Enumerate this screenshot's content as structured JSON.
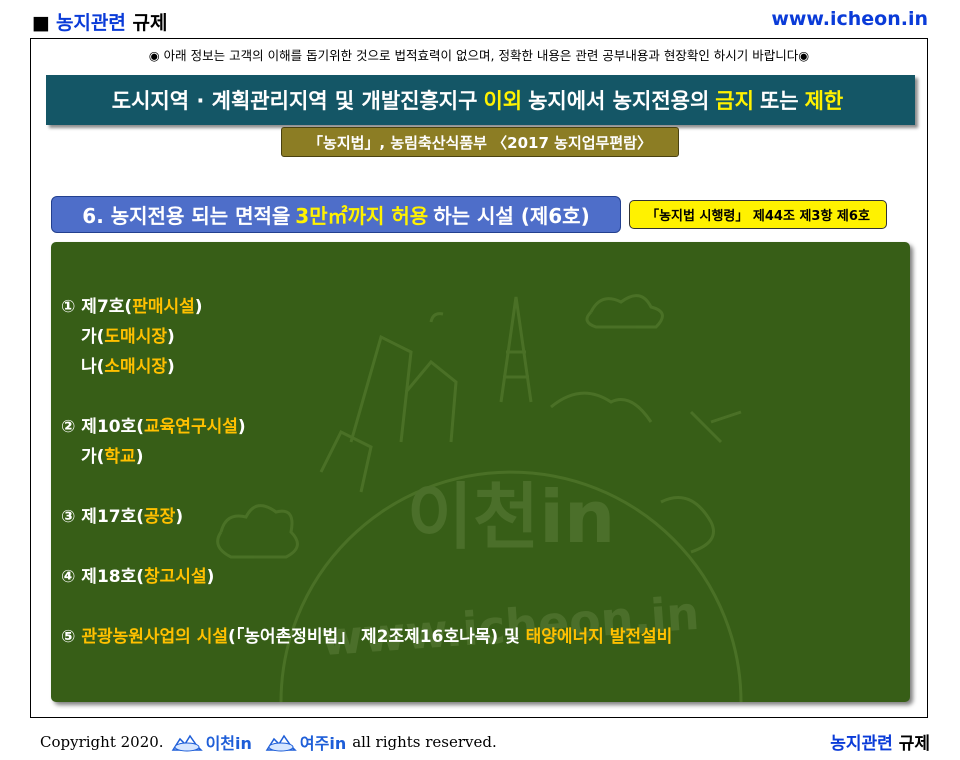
{
  "header": {
    "square": "■",
    "title_highlight": "농지관련",
    "title_rest": "규제",
    "site_url": "www.icheon.in"
  },
  "notice": "◉ 아래 정보는 고객의 이해를 돕기위한 것으로 법적효력이 없으며, 정확한 내용은 관련 공부내용과 현장확인 하시기 바랍니다◉",
  "banner": {
    "part1": "도시지역 · 계획관리지역 및 개발진흥지구",
    "highlight1": "이외",
    "part2": "농지에서 농지전용의",
    "highlight2": "금지",
    "part3": "또는",
    "highlight3": "제한"
  },
  "source": "「농지법」, 농림축산식품부 〈2017 농지업무편람〉",
  "section": {
    "prefix": "6. 농지전용 되는 면적을",
    "highlight": "3만㎡까지 허용",
    "suffix": "하는 시설 (제6호)"
  },
  "law_ref": "「농지법 시행령」 제44조 제3항 제6호",
  "items": {
    "i1": {
      "num": "① 제7호(",
      "name": "판매시설",
      "close": ")"
    },
    "i1a": {
      "num": "가(",
      "name": "도매시장",
      "close": ")"
    },
    "i1b": {
      "num": "나(",
      "name": "소매시장",
      "close": ")"
    },
    "i2": {
      "num": "② 제10호(",
      "name": "교육연구시설",
      "close": ")"
    },
    "i2a": {
      "num": "가(",
      "name": "학교",
      "close": ")"
    },
    "i3": {
      "num": "③ 제17호(",
      "name": "공장",
      "close": ")"
    },
    "i4": {
      "num": "④ 제18호(",
      "name": "창고시설",
      "close": ")"
    },
    "i5": {
      "num": "⑤",
      "name1": "관광농원사업의 시설",
      "mid": "(「농어촌정비법」 제2조제16호나목) 및",
      "name2": "태양에너지 발전설비"
    }
  },
  "watermark": {
    "main": "이천in",
    "url": "www.icheon.in"
  },
  "footer": {
    "copyright": "Copyright 2020.",
    "logo1": "이천in",
    "logo2": "여주in",
    "rights": "all rights reserved.",
    "cat_highlight": "농지관련",
    "cat_rest": "규제"
  },
  "colors": {
    "banner_bg": "#145666",
    "content_bg": "#375e17",
    "section_bg": "#4e6ec9",
    "source_bg": "#8c7d24",
    "accent_yellow": "#fff200",
    "item_highlight": "#ffc000",
    "link_blue": "#0a3bd8"
  }
}
